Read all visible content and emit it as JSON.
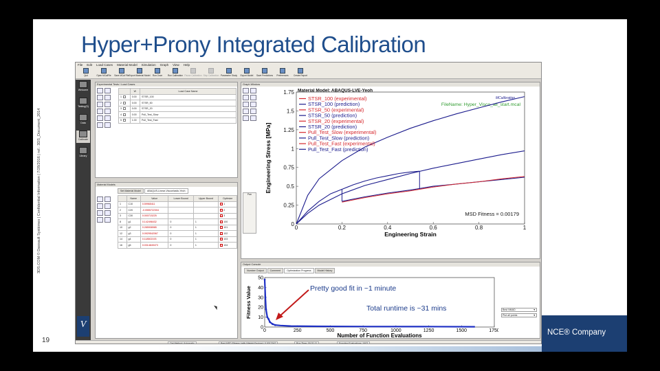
{
  "slide": {
    "title": "Hyper+Prony Integrated Calibration",
    "sidebar_text": "3DS.COM © Dassault Systèmes | Confidential Information | 7/28/2016 | ref.: 3DS_Document_2014",
    "page_number": "19",
    "brand_text": "NCE® Company",
    "accent": "#1f4e8c"
  },
  "app": {
    "menu": [
      "File",
      "Edit",
      "Load Cases",
      "Material Model",
      "Simulation",
      "Graph",
      "View",
      "Help"
    ],
    "toolbar": [
      {
        "label": "Quit",
        "enabled": true
      },
      {
        "label": "Open MCalFile",
        "enabled": true
      },
      {
        "label": "Save MCal File",
        "enabled": true
      },
      {
        "label": "Export Material Model",
        "enabled": true
      },
      {
        "label": "Run Once",
        "enabled": true
      },
      {
        "label": "Run Calibration",
        "enabled": true
      },
      {
        "label": "Pause Calibration",
        "enabled": false
      },
      {
        "label": "Stop Calibration",
        "enabled": false
      },
      {
        "label": "Parameter Study",
        "enabled": true
      },
      {
        "label": "Export Model",
        "enabled": true
      },
      {
        "label": "Save Predictions",
        "enabled": true
      },
      {
        "label": "Preferences",
        "enabled": true
      },
      {
        "label": "Create Report",
        "enabled": true
      }
    ],
    "nav": [
      {
        "label": "Welcome",
        "active": false
      },
      {
        "label": "Testing(S)",
        "active": false
      },
      {
        "label": "Data",
        "active": false
      },
      {
        "label": "Calibrate",
        "active": true
      },
      {
        "label": "Library",
        "active": false
      }
    ],
    "experiments_panel": {
      "title": "Experimental Tests / Load Cases",
      "columns": [
        "",
        "W",
        "Load Case Name"
      ],
      "rows": [
        {
          "num": "1",
          "w": "0.00",
          "name": "STSR_100"
        },
        {
          "num": "2",
          "w": "0.00",
          "name": "STSR_50"
        },
        {
          "num": "3",
          "w": "0.00",
          "name": "STSR_20"
        },
        {
          "num": "4",
          "w": "0.00",
          "name": "Pull_Test_Slow"
        },
        {
          "num": "5",
          "w": "1.00",
          "name": "Pull_Test_Fast"
        }
      ]
    },
    "material_panel": {
      "title": "Material Models",
      "tabs": [
        "Set Material Model",
        "ABAQUS-Linear-Viscoelastic-Yeoh"
      ],
      "columns": [
        "",
        "Name",
        "Value",
        "Lower Bound",
        "Upper Bound",
        "Optimize"
      ],
      "rows": [
        {
          "num": "1",
          "name": "C10",
          "value": "0.59965411",
          "lower": "",
          "upper": "",
          "opt": "1"
        },
        {
          "num": "2",
          "name": "C20",
          "value": "-0.0555722304",
          "lower": "",
          "upper": "",
          "opt": "2"
        },
        {
          "num": "3",
          "name": "C30",
          "value": "0.000715225",
          "lower": "",
          "upper": "",
          "opt": "3"
        },
        {
          "num": "8",
          "name": "g1",
          "value": "0.142498432",
          "lower": "0",
          "upper": "1",
          "opt": "100"
        },
        {
          "num": "10",
          "name": "g2",
          "value": "0.285908985",
          "lower": "0",
          "upper": "1",
          "opt": "101"
        },
        {
          "num": "12",
          "name": "g3",
          "value": "0.0929542067",
          "lower": "0",
          "upper": "1",
          "opt": "102"
        },
        {
          "num": "14",
          "name": "g4",
          "value": "0.118502193",
          "lower": "0",
          "upper": "1",
          "opt": "103"
        },
        {
          "num": "16",
          "name": "g5",
          "value": "0.0314849473",
          "lower": "0",
          "upper": "1",
          "opt": "104"
        }
      ]
    },
    "graph_panel": {
      "title": "Graph Window",
      "zoom_label": "Pan"
    },
    "output_panel": {
      "title": "Output Console",
      "tabs": [
        "Number Output",
        "Comment",
        "Optimization Progress",
        "Model History"
      ],
      "options": [
        "Best NMAD",
        "Plot all points"
      ]
    },
    "status": [
      "Opt Method: Automatic",
      "Best MSD Fitness (with Weight Factors): 0.0017947",
      "Run Time: 00:31:11",
      "Function Evaluations: 1602"
    ]
  },
  "chart_data": [
    {
      "type": "line",
      "title": "Material Model: ABAQUS-LVE-Yeoh",
      "xlabel": "Engineering Strain",
      "ylabel": "Engineering Stress [MPa]",
      "xlim": [
        0,
        1
      ],
      "ylim": [
        0,
        1.75
      ],
      "xticks": [
        "0",
        "0.2",
        "0.4",
        "0.6",
        "0.8",
        "1"
      ],
      "yticks": [
        "0",
        "0.25",
        "0.5",
        "0.75",
        "1",
        "1.25",
        "1.5",
        "1.75"
      ],
      "legend": [
        {
          "name": "STSR_100 (experimental)",
          "color": "#d6262b"
        },
        {
          "name": "STSR_100 (prediction)",
          "color": "#1a1a8c"
        },
        {
          "name": "STSR_50 (experimental)",
          "color": "#d6262b"
        },
        {
          "name": "STSR_50 (prediction)",
          "color": "#1a1a8c"
        },
        {
          "name": "STSR_20 (experimental)",
          "color": "#d6262b"
        },
        {
          "name": "STSR_20 (prediction)",
          "color": "#1a1a8c"
        },
        {
          "name": "Pull_Test_Slow (experimental)",
          "color": "#d6262b"
        },
        {
          "name": "Pull_Test_Slow (prediction)",
          "color": "#1a1a8c"
        },
        {
          "name": "Pull_Test_Fast (experimental)",
          "color": "#d6262b"
        },
        {
          "name": "Pull_Test_Fast (prediction)",
          "color": "#1a1a8c"
        }
      ],
      "logo_text": "MCalibration",
      "filename_label": "FileName: Hyper_Visco_all_start.mcal",
      "fitness_label": "MSD Fitness = 0.00179",
      "series": [
        {
          "x": [
            0,
            0.05,
            0.1,
            0.2,
            0.3,
            0.4,
            0.5,
            0.6,
            0.7,
            0.8,
            0.9,
            1.0
          ],
          "y": [
            0,
            0.38,
            0.6,
            0.84,
            1.02,
            1.15,
            1.27,
            1.37,
            1.46,
            1.54,
            1.62,
            1.69
          ]
        },
        {
          "x": [
            0,
            0.05,
            0.1,
            0.2,
            0.3,
            0.4,
            0.5,
            0.6,
            0.7,
            0.8,
            0.9,
            1.0
          ],
          "y": [
            0,
            0.14,
            0.25,
            0.4,
            0.51,
            0.59,
            0.67,
            0.74,
            0.8,
            0.86,
            0.92,
            0.97
          ]
        },
        {
          "x": [
            0,
            0.05,
            0.1,
            0.15,
            0.2,
            0.25,
            0.3,
            0.35,
            0.4,
            0.45,
            0.5,
            0.54
          ],
          "y": [
            0,
            0.17,
            0.3,
            0.4,
            0.46,
            0.52,
            0.57,
            0.61,
            0.64,
            0.67,
            0.69,
            0.7
          ]
        },
        {
          "x": [
            0.2,
            0.3,
            0.4,
            0.5,
            0.54,
            0.6,
            0.7,
            0.8,
            0.9,
            1.0
          ],
          "y": [
            0.3,
            0.36,
            0.41,
            0.45,
            0.47,
            0.5,
            0.53,
            0.56,
            0.59,
            0.62
          ]
        },
        {
          "x": [
            0.2,
            0.3,
            0.4,
            0.5,
            0.54,
            0.6,
            0.7,
            0.8,
            0.9,
            1.0
          ],
          "y": [
            0.29,
            0.35,
            0.4,
            0.44,
            0.46,
            0.49,
            0.53,
            0.56,
            0.6,
            0.63
          ]
        }
      ]
    },
    {
      "type": "line",
      "xlabel": "Number of Function Evaluations",
      "ylabel": "Fitness Value",
      "xlim": [
        0,
        1750
      ],
      "ylim": [
        0,
        50
      ],
      "xticks": [
        "0",
        "250",
        "500",
        "750",
        "1000",
        "1250",
        "1500",
        "1750"
      ],
      "yticks": [
        "0",
        "10",
        "20",
        "30",
        "40",
        "50"
      ],
      "annotations": [
        "Pretty good fit in ~1 minute",
        "Total runtime is ~31 mins"
      ],
      "series": [
        {
          "x": [
            0,
            5,
            10,
            20,
            30,
            40,
            60,
            80,
            120,
            200,
            400,
            800,
            1200,
            1602
          ],
          "y": [
            48,
            30,
            18,
            10,
            8,
            5,
            3,
            2,
            1.5,
            1,
            0.7,
            0.5,
            0.4,
            0.3
          ]
        }
      ]
    }
  ]
}
